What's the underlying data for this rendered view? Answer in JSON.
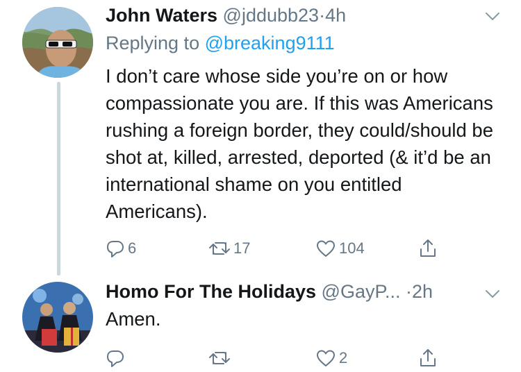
{
  "tweets": [
    {
      "name": "John Waters",
      "handle": "@jddubb23",
      "separator": "·",
      "time": "4h",
      "reply_prefix": "Replying to",
      "reply_to": "@breaking9111",
      "text": "I don’t care whose side you’re on or how compassionate you are. If this was Americans rushing a foreign border, they could/should be shot at, killed, arrested, deported (& it’d be an international shame on you entitled Americans).",
      "replies": "6",
      "retweets": "17",
      "likes": "104"
    },
    {
      "name": "Homo For The Holidays",
      "handle": "@GayP...",
      "separator": "·",
      "time": "2h",
      "text": "Amen.",
      "replies": "",
      "retweets": "",
      "likes": "2"
    }
  ],
  "colors": {
    "text": "#14171a",
    "secondary": "#657786",
    "link": "#1da1f2",
    "thread_line": "#ccd6dd"
  },
  "icons": [
    "reply-icon",
    "retweet-icon",
    "like-icon",
    "share-icon",
    "chevron-down-icon"
  ]
}
